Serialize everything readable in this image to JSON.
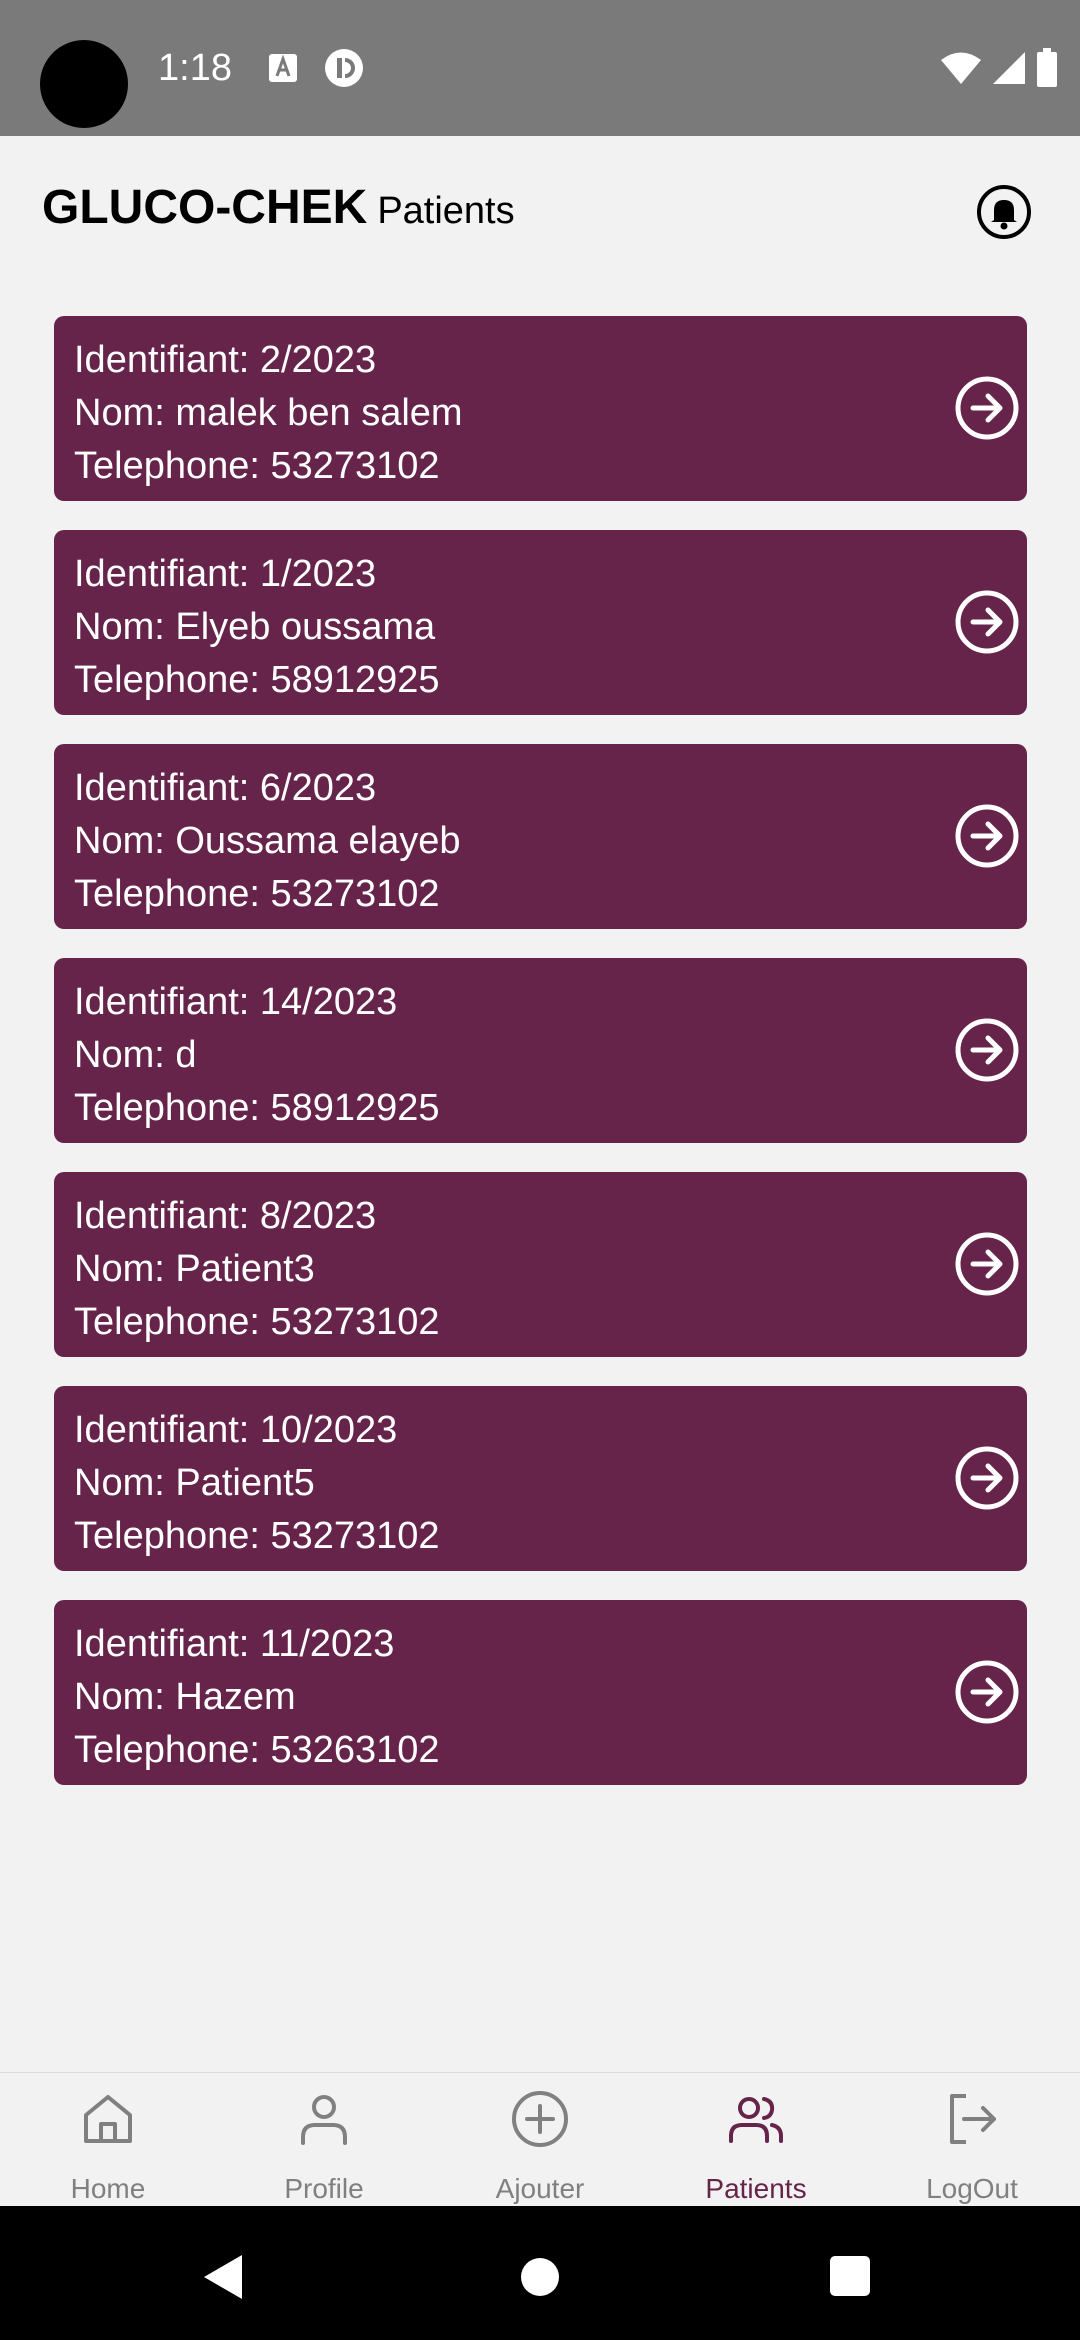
{
  "status_bar": {
    "time": "1:18"
  },
  "header": {
    "app_title": "GLUCO-CHEK",
    "page_subtitle": "Patients"
  },
  "patients": [
    {
      "id_label": "Identifiant: 2/2023",
      "name_label": "Nom: malek ben salem",
      "phone_label": "Telephone: 53273102"
    },
    {
      "id_label": "Identifiant: 1/2023",
      "name_label": "Nom: Elyeb oussama",
      "phone_label": "Telephone: 58912925"
    },
    {
      "id_label": "Identifiant: 6/2023",
      "name_label": "Nom: Oussama elayeb",
      "phone_label": "Telephone: 53273102"
    },
    {
      "id_label": "Identifiant: 14/2023",
      "name_label": "Nom: d",
      "phone_label": "Telephone: 58912925"
    },
    {
      "id_label": "Identifiant: 8/2023",
      "name_label": "Nom: Patient3",
      "phone_label": "Telephone: 53273102"
    },
    {
      "id_label": "Identifiant: 10/2023",
      "name_label": "Nom: Patient5",
      "phone_label": "Telephone: 53273102"
    },
    {
      "id_label": "Identifiant: 11/2023",
      "name_label": "Nom: Hazem",
      "phone_label": "Telephone: 53263102"
    }
  ],
  "bottom_nav": {
    "items": [
      {
        "label": "Home",
        "icon": "home-icon"
      },
      {
        "label": "Profile",
        "icon": "person-icon"
      },
      {
        "label": "Ajouter",
        "icon": "add-circle-icon"
      },
      {
        "label": "Patients",
        "icon": "people-icon",
        "active": true
      },
      {
        "label": "LogOut",
        "icon": "logout-icon"
      }
    ]
  },
  "colors": {
    "card_background": "#66244a",
    "active_nav": "#66244a",
    "inactive_nav": "#808080",
    "page_background": "#f2f2f2",
    "status_bar": "#7a7a7a"
  }
}
